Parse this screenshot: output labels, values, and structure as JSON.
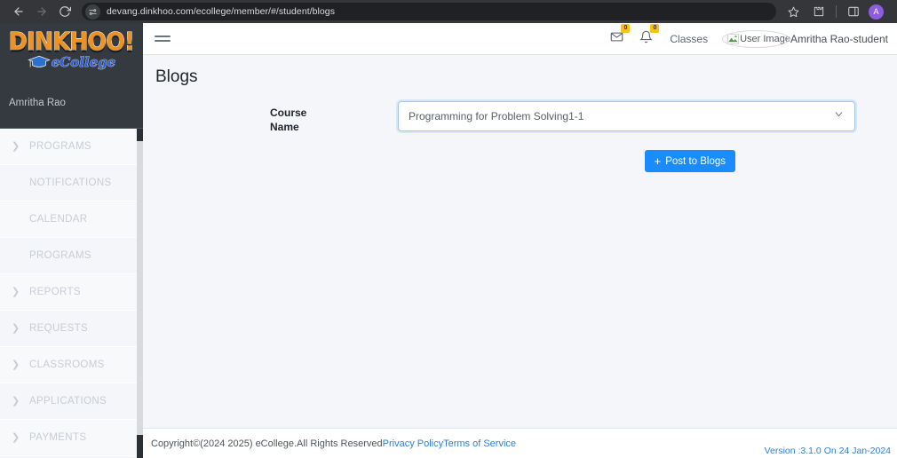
{
  "browser": {
    "back_icon": "arrow-left",
    "forward_icon": "arrow-right",
    "reload_icon": "reload",
    "url": "devang.dinkhoo.com/ecollege/member/#/student/blogs",
    "site_settings_icon": "tune-icon",
    "bookmark_icon": "star-icon",
    "extensions_icon": "puzzle-icon",
    "side_panel_icon": "side-panel-icon",
    "profile_initial": "A"
  },
  "sidebar": {
    "logo_main": "DINKHOO!",
    "logo_sub": "eCollege",
    "user_name": "Amritha Rao",
    "items": [
      {
        "label": "PROGRAMS",
        "has_chevron": true
      },
      {
        "label": "NOTIFICATIONS",
        "has_chevron": false
      },
      {
        "label": "CALENDAR",
        "has_chevron": false
      },
      {
        "label": "PROGRAMS",
        "has_chevron": false
      },
      {
        "label": "REPORTS",
        "has_chevron": true
      },
      {
        "label": "REQUESTS",
        "has_chevron": true
      },
      {
        "label": "CLASSROOMS",
        "has_chevron": true
      },
      {
        "label": "APPLICATIONS",
        "has_chevron": true
      },
      {
        "label": "PAYMENTS",
        "has_chevron": true
      }
    ]
  },
  "topnav": {
    "menu_toggle_icon": "hamburger-icon",
    "messages_icon": "envelope-icon",
    "messages_count": "0",
    "notifications_icon": "bell-icon",
    "notifications_count": "0",
    "classes_link": "Classes",
    "avatar_alt": "User Image",
    "user_label": "Amritha Rao-student"
  },
  "main": {
    "page_title": "Blogs",
    "course_label_line1": "Course",
    "course_label_line2": "Name",
    "course_selected": "Programming for Problem Solving1-1",
    "course_options": [
      "Programming for Problem Solving1-1"
    ],
    "select_chevron_icon": "chevron-down-icon",
    "post_button_icon": "plus-icon",
    "post_button_label": "Post to Blogs"
  },
  "footer": {
    "copyright": "Copyright©(2024 2025) eCollege.All Rights Reserved",
    "privacy_policy": "Privacy Policy",
    "terms_of_service": "Terms of Service",
    "version": "Version :3.1.0 On 24 Jan-2024"
  },
  "colors": {
    "sidebar_bg": "#343a40",
    "accent_blue": "#1a8cff",
    "link_blue": "#2f7fd6",
    "badge_yellow": "#ffc107",
    "logo_orange": "#f0921f"
  }
}
